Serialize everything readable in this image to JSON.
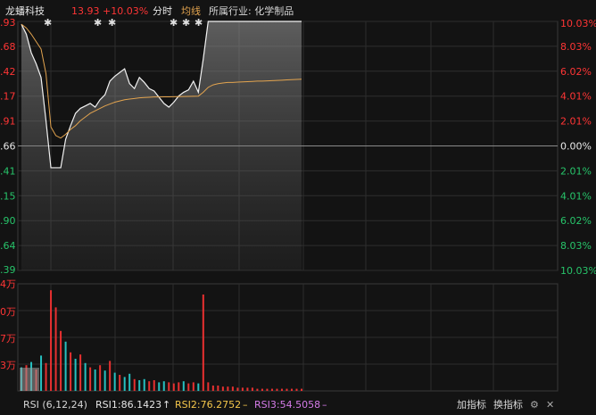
{
  "header": {
    "stock_name": "龙蟠科技",
    "price": "13.93",
    "change": "+10.03%",
    "mode_label": "分时",
    "avg_label": "均线",
    "industry": "所属行业: 化学制品"
  },
  "price_axis_left": [
    ".93",
    ".68",
    ".42",
    ".17",
    ".91",
    ".66",
    ".41",
    ".15",
    ".90",
    ".64",
    ".39"
  ],
  "pct_axis_right": [
    "10.03%",
    "8.03%",
    "6.02%",
    "4.01%",
    "2.01%",
    "0.00%",
    "2.01%",
    "4.01%",
    "6.02%",
    "8.03%",
    "10.03%"
  ],
  "volume_axis_left": [
    "4万",
    "0万",
    "7万",
    "3万"
  ],
  "colors": {
    "up": "#ff3535",
    "down": "#27c46a",
    "neutral": "#e8e8e8",
    "avg_line": "#e3a44f",
    "rsi2": "#f5c74b",
    "rsi3": "#d57be8",
    "vol_up": "#e83030",
    "vol_down": "#26c0c0"
  },
  "footer": {
    "rsi_label": "RSI (6,12,24)",
    "rsi1": "RSI1:86.1423",
    "rsi1_arrow": "↑",
    "rsi2": "RSI2:76.2752",
    "rsi2_arrow": "–",
    "rsi3": "RSI3:54.5058",
    "rsi3_arrow": "–",
    "add_indicator": "加指标",
    "switch_indicator": "换指标",
    "settings_icon": "gear-icon",
    "close_icon": "close-icon"
  },
  "chart_data": {
    "type": "line",
    "title": "",
    "xlabel": "",
    "ylabel": "",
    "ylim_pct": [
      -10.03,
      10.03
    ],
    "markers": [
      "star",
      "star",
      "star",
      "star",
      "star",
      "star"
    ],
    "price_pct": [
      9.8,
      9.0,
      7.5,
      6.6,
      5.5,
      2.0,
      -1.8,
      -1.8,
      -1.8,
      0.5,
      1.6,
      2.6,
      3.0,
      3.2,
      3.4,
      3.1,
      3.7,
      4.1,
      5.2,
      5.6,
      5.9,
      6.2,
      5.0,
      4.6,
      5.5,
      5.1,
      4.6,
      4.4,
      3.9,
      3.4,
      3.1,
      3.5,
      4.0,
      4.3,
      4.5,
      5.2,
      4.3,
      7.0,
      10.03,
      10.03,
      10.03,
      10.03,
      10.03,
      10.03,
      10.03,
      10.03,
      10.03,
      10.03,
      10.03,
      10.03,
      10.03,
      10.03,
      10.03,
      10.03,
      10.03,
      10.03,
      10.03,
      10.03
    ],
    "avg_pct": [
      9.8,
      9.5,
      9.0,
      8.4,
      7.8,
      5.8,
      1.5,
      0.8,
      0.6,
      0.9,
      1.3,
      1.6,
      2.0,
      2.3,
      2.6,
      2.8,
      3.0,
      3.2,
      3.35,
      3.5,
      3.6,
      3.7,
      3.75,
      3.8,
      3.85,
      3.88,
      3.9,
      3.92,
      3.92,
      3.93,
      3.93,
      3.94,
      3.95,
      3.96,
      3.97,
      3.98,
      3.99,
      4.3,
      4.7,
      4.9,
      5.0,
      5.05,
      5.1,
      5.1,
      5.12,
      5.14,
      5.16,
      5.18,
      5.2,
      5.2,
      5.22,
      5.24,
      5.26,
      5.28,
      5.3,
      5.32,
      5.34,
      5.36
    ],
    "volume": [
      0.22,
      0.24,
      0.27,
      0.2,
      0.33,
      0.26,
      0.94,
      0.78,
      0.56,
      0.46,
      0.36,
      0.3,
      0.34,
      0.26,
      0.22,
      0.2,
      0.24,
      0.19,
      0.28,
      0.17,
      0.15,
      0.13,
      0.16,
      0.11,
      0.1,
      0.11,
      0.09,
      0.1,
      0.08,
      0.09,
      0.08,
      0.07,
      0.08,
      0.09,
      0.07,
      0.08,
      0.07,
      0.9,
      0.08,
      0.05,
      0.05,
      0.04,
      0.04,
      0.04,
      0.03,
      0.03,
      0.03,
      0.03,
      0.02,
      0.02,
      0.02,
      0.02,
      0.02,
      0.02,
      0.02,
      0.02,
      0.02,
      0.02
    ],
    "volume_dir": [
      "d",
      "u",
      "d",
      "u",
      "d",
      "u",
      "u",
      "u",
      "u",
      "d",
      "u",
      "d",
      "u",
      "d",
      "u",
      "d",
      "u",
      "d",
      "u",
      "d",
      "u",
      "d",
      "d",
      "u",
      "d",
      "d",
      "u",
      "u",
      "d",
      "d",
      "u",
      "u",
      "u",
      "d",
      "u",
      "u",
      "d",
      "u",
      "u",
      "u",
      "u",
      "u",
      "u",
      "u",
      "u",
      "u",
      "u",
      "u",
      "u",
      "u",
      "u",
      "u",
      "u",
      "u",
      "u",
      "u",
      "u",
      "u"
    ]
  }
}
